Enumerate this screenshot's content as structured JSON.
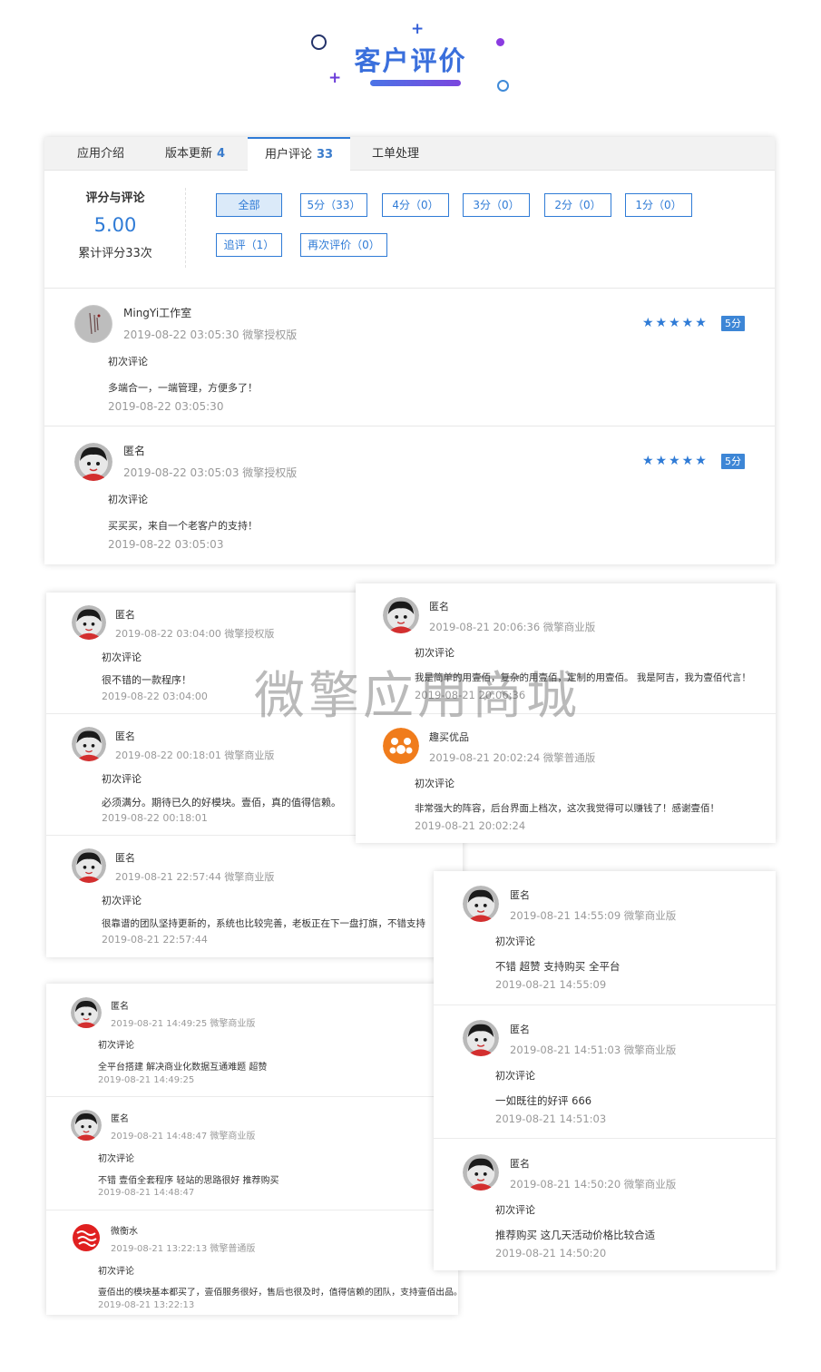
{
  "header": {
    "title": "客户评价"
  },
  "tabs": [
    {
      "label": "应用介绍",
      "count": ""
    },
    {
      "label": "版本更新",
      "count": "4"
    },
    {
      "label": "用户评论",
      "count": "33"
    },
    {
      "label": "工单处理",
      "count": ""
    }
  ],
  "rating": {
    "label": "评分与评论",
    "score": "5.00",
    "count_text": "累计评分33次"
  },
  "filters": [
    "全部",
    "5分（33）",
    "4分（0）",
    "3分（0）",
    "2分（0）",
    "1分（0）",
    "追评（1）",
    "再次评价（0）"
  ],
  "main_reviews": [
    {
      "name": "MingYi工作室",
      "meta": "2019-08-22 03:05:30 微擎授权版",
      "tag": "初次评论",
      "text": "多端合一，一端管理，方便多了！",
      "date": "2019-08-22 03:05:30",
      "stars": "★★★★★",
      "score": "5分"
    },
    {
      "name": "匿名",
      "meta": "2019-08-22 03:05:03 微擎授权版",
      "tag": "初次评论",
      "text": "买买买，来自一个老客户的支持！",
      "date": "2019-08-22 03:05:03",
      "stars": "★★★★★",
      "score": "5分"
    }
  ],
  "panel_a": [
    {
      "name": "匿名",
      "meta": "2019-08-22 03:04:00 微擎授权版",
      "tag": "初次评论",
      "text": "很不错的一款程序！",
      "date": "2019-08-22 03:04:00"
    },
    {
      "name": "匿名",
      "meta": "2019-08-22 00:18:01 微擎商业版",
      "tag": "初次评论",
      "text": "必须满分。期待已久的好模块。壹佰，真的值得信赖。",
      "date": "2019-08-22 00:18:01"
    },
    {
      "name": "匿名",
      "meta": "2019-08-21 22:57:44 微擎商业版",
      "tag": "初次评论",
      "text": "很靠谱的团队坚持更新的，系统也比较完善，老板正在下一盘打旗，不错支持",
      "date": "2019-08-21 22:57:44"
    }
  ],
  "panel_b": [
    {
      "name": "匿名",
      "meta": "2019-08-21 20:06:36 微擎商业版",
      "tag": "初次评论",
      "text": "我是简单的用壹佰，复杂的用壹佰，定制的用壹佰。 我是阿吉，我为壹佰代言！",
      "date": "2019-08-21 20:06:36"
    },
    {
      "name": "趣买优品",
      "meta": "2019-08-21 20:02:24 微擎普通版",
      "tag": "初次评论",
      "text": "非常强大的阵容，后台界面上档次，这次我觉得可以赚钱了！感谢壹佰！",
      "date": "2019-08-21 20:02:24"
    }
  ],
  "panel_c": [
    {
      "name": "匿名",
      "meta": "2019-08-21 14:55:09 微擎商业版",
      "tag": "初次评论",
      "text": "不错 超赞 支持购买 全平台",
      "date": "2019-08-21 14:55:09"
    },
    {
      "name": "匿名",
      "meta": "2019-08-21 14:51:03 微擎商业版",
      "tag": "初次评论",
      "text": "一如既往的好评 666",
      "date": "2019-08-21 14:51:03"
    },
    {
      "name": "匿名",
      "meta": "2019-08-21 14:50:20 微擎商业版",
      "tag": "初次评论",
      "text": "推荐购买 这几天活动价格比较合适",
      "date": "2019-08-21 14:50:20"
    }
  ],
  "panel_d": [
    {
      "name": "匿名",
      "meta": "2019-08-21 14:49:25 微擎商业版",
      "tag": "初次评论",
      "text": "全平台搭建 解决商业化数据互通难题 超赞",
      "date": "2019-08-21 14:49:25"
    },
    {
      "name": "匿名",
      "meta": "2019-08-21 14:48:47 微擎商业版",
      "tag": "初次评论",
      "text": "不错 壹佰全套程序 轻站的思路很好 推荐购买",
      "date": "2019-08-21 14:48:47"
    },
    {
      "name": "微衡水",
      "meta": "2019-08-21 13:22:13 微擎普通版",
      "tag": "初次评论",
      "text": "壹佰出的模块基本都买了，壹佰服务很好，售后也很及时，值得信赖的团队，支持壹佰出品。",
      "date": "2019-08-21 13:22:13"
    }
  ],
  "watermark": "微擎应用商城"
}
